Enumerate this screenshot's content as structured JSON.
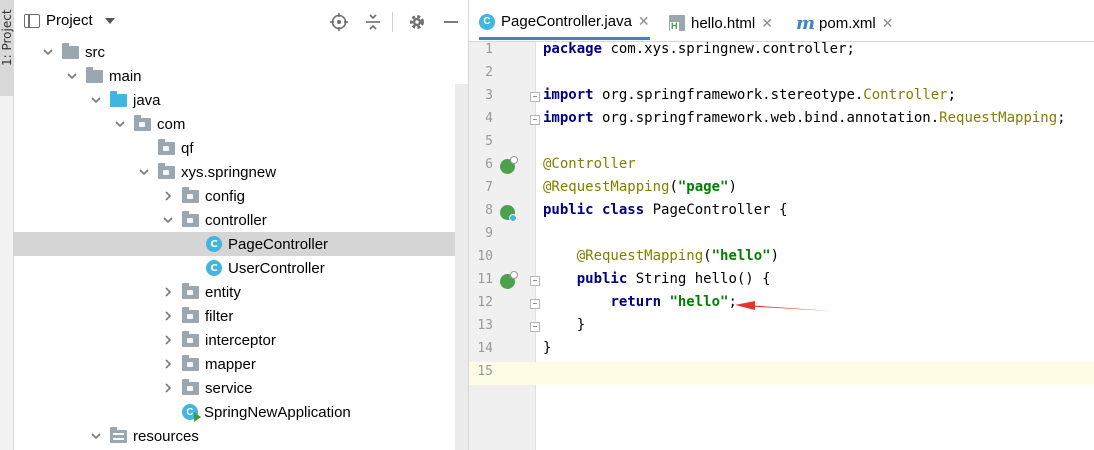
{
  "stripe": {
    "label": "1: Project"
  },
  "project_panel": {
    "title": "Project",
    "tree": [
      {
        "label": "src",
        "depth": 0,
        "kind": "folder",
        "color": "grey",
        "expanded": true
      },
      {
        "label": "main",
        "depth": 1,
        "kind": "folder",
        "color": "grey",
        "expanded": true
      },
      {
        "label": "java",
        "depth": 2,
        "kind": "folder",
        "color": "blue",
        "expanded": true
      },
      {
        "label": "com",
        "depth": 3,
        "kind": "package",
        "expanded": true
      },
      {
        "label": "qf",
        "depth": 4,
        "kind": "package",
        "expanded": null
      },
      {
        "label": "xys.springnew",
        "depth": 4,
        "kind": "package",
        "expanded": true
      },
      {
        "label": "config",
        "depth": 5,
        "kind": "package",
        "expanded": false
      },
      {
        "label": "controller",
        "depth": 5,
        "kind": "package",
        "expanded": true
      },
      {
        "label": "PageController",
        "depth": 6,
        "kind": "class",
        "selected": true
      },
      {
        "label": "UserController",
        "depth": 6,
        "kind": "class"
      },
      {
        "label": "entity",
        "depth": 5,
        "kind": "package",
        "expanded": false
      },
      {
        "label": "filter",
        "depth": 5,
        "kind": "package",
        "expanded": false
      },
      {
        "label": "interceptor",
        "depth": 5,
        "kind": "package",
        "expanded": false
      },
      {
        "label": "mapper",
        "depth": 5,
        "kind": "package",
        "expanded": false
      },
      {
        "label": "service",
        "depth": 5,
        "kind": "package",
        "expanded": false
      },
      {
        "label": "SpringNewApplication",
        "depth": 5,
        "kind": "app"
      },
      {
        "label": "resources",
        "depth": 2,
        "kind": "resources",
        "expanded": true
      }
    ]
  },
  "editor": {
    "tabs": [
      {
        "label": "PageController.java",
        "icon": "class-icon",
        "active": true
      },
      {
        "label": "hello.html",
        "icon": "html-file-icon",
        "active": false
      },
      {
        "label": "pom.xml",
        "icon": "maven-icon",
        "active": false
      }
    ],
    "lines": [
      {
        "n": "1",
        "parts": [
          [
            "kw",
            "package"
          ],
          [
            "",
            "com.xys.springnew.controller;"
          ]
        ]
      },
      {
        "n": "2",
        "parts": []
      },
      {
        "n": "3",
        "fold": true,
        "parts": [
          [
            "kw",
            "import"
          ],
          [
            "",
            " org.springframework.stereotype."
          ],
          [
            "ty",
            "Controller"
          ],
          [
            "",
            ";"
          ]
        ]
      },
      {
        "n": "4",
        "fold": true,
        "parts": [
          [
            "kw",
            "import"
          ],
          [
            "",
            " org.springframework.web.bind.annotation."
          ],
          [
            "ty",
            "RequestMapping"
          ],
          [
            "",
            ";"
          ]
        ]
      },
      {
        "n": "5",
        "parts": []
      },
      {
        "n": "6",
        "gicon": "bean-check",
        "parts": [
          [
            "ann",
            "@Controller"
          ]
        ]
      },
      {
        "n": "7",
        "parts": [
          [
            "ann",
            "@RequestMapping"
          ],
          [
            "",
            "("
          ],
          [
            "str",
            "\"page\""
          ],
          [
            "",
            ")"
          ]
        ]
      },
      {
        "n": "8",
        "gicon": "bean",
        "parts": [
          [
            "kw",
            "public class"
          ],
          [
            "",
            " PageController {"
          ]
        ]
      },
      {
        "n": "9",
        "parts": []
      },
      {
        "n": "10",
        "parts": [
          [
            "",
            "    "
          ],
          [
            "ann",
            "@RequestMapping"
          ],
          [
            "",
            "("
          ],
          [
            "str",
            "\"hello\""
          ],
          [
            "",
            ")"
          ]
        ]
      },
      {
        "n": "11",
        "gicon": "web",
        "fold": true,
        "parts": [
          [
            "",
            "    "
          ],
          [
            "kw",
            "public"
          ],
          [
            "",
            " String hello() {"
          ]
        ]
      },
      {
        "n": "12",
        "fold": true,
        "parts": [
          [
            "",
            "        "
          ],
          [
            "kw",
            "return"
          ],
          [
            "",
            " "
          ],
          [
            "str",
            "\"hello\""
          ],
          [
            "",
            ";"
          ]
        ]
      },
      {
        "n": "13",
        "fold": true,
        "parts": [
          [
            "",
            "    }"
          ]
        ]
      },
      {
        "n": "14",
        "parts": [
          [
            "",
            "}"
          ]
        ]
      },
      {
        "n": "15",
        "current": true,
        "parts": []
      }
    ]
  },
  "colors": {
    "keyword": "#000080",
    "annotation": "#808000",
    "string": "#008000",
    "accent": "#4083c9",
    "arrow": "#e8322c",
    "current_line": "#fefce5"
  }
}
